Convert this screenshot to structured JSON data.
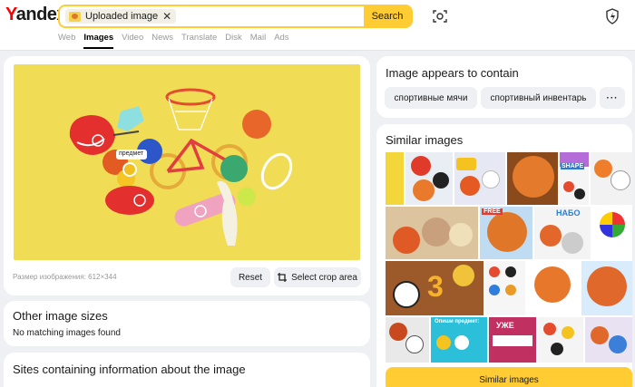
{
  "header": {
    "logo": "Yandex",
    "search_chip_label": "Uploaded image",
    "search_button": "Search"
  },
  "nav": {
    "tabs": [
      "Web",
      "Images",
      "Video",
      "News",
      "Translate",
      "Disk",
      "Mail",
      "Ads"
    ],
    "active": "Images"
  },
  "image_panel": {
    "hotspot_label": "предмет",
    "size_text": "Размер изображения: 612×344",
    "reset_button": "Reset",
    "crop_button": "Select crop area"
  },
  "other_sizes": {
    "title": "Other image sizes",
    "message": "No matching images found"
  },
  "sites": {
    "title": "Sites containing information about the image"
  },
  "contains": {
    "title": "Image appears to contain",
    "tags": [
      "спортивные мячи",
      "спортивный инвентарь"
    ],
    "more": "···"
  },
  "similar": {
    "title": "Similar images",
    "button": "Similar images",
    "thumb_texts": [
      "SHAPE",
      "FREE",
      "НАБО",
      "3",
      "УЖЕ",
      "Опиши предмет:"
    ]
  },
  "colors": {
    "accent": "#ffcc33",
    "image_bg": "#f0dc55"
  }
}
